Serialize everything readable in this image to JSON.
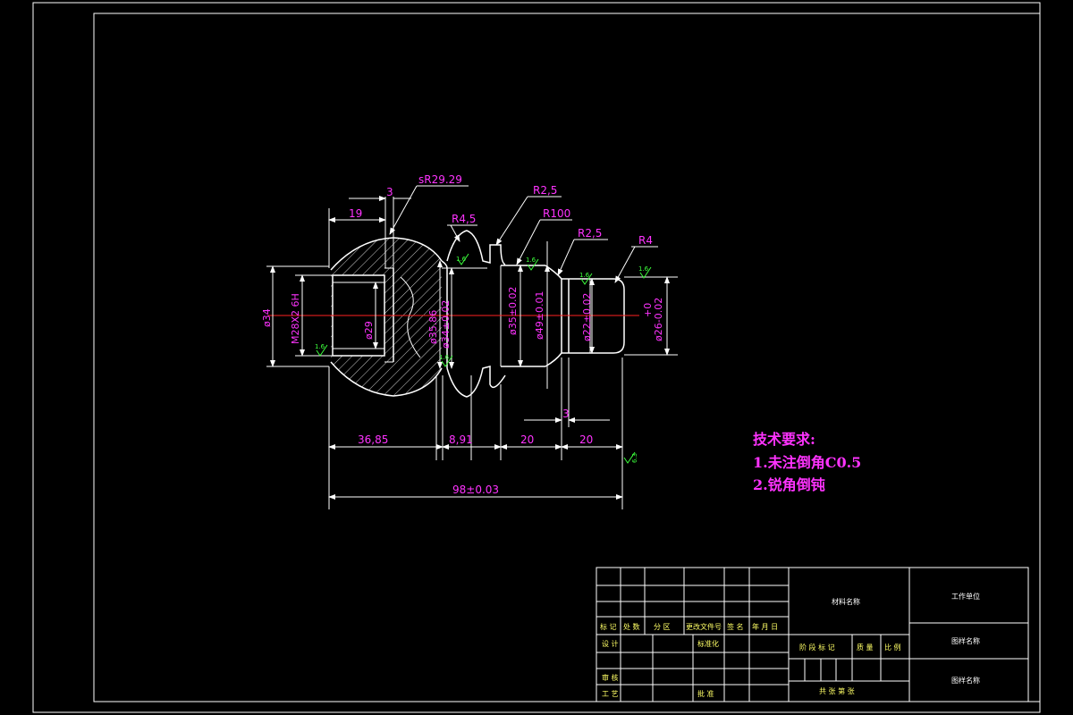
{
  "dimensions": {
    "sr": "sR29.29",
    "d3_top": "3",
    "d19": "19",
    "r45": "R4,5",
    "r25a": "R2,5",
    "r100": "R100",
    "r25b": "R2,5",
    "r4": "R4",
    "phi34": "ø34",
    "m28": "M28X2 6H",
    "phi29": "ø29",
    "phi3586": "ø35.86",
    "phi34tol": "ø34±0.02",
    "phi35tol": "ø35±0.02",
    "phi49": "ø49±0.01",
    "phi22": "ø22±0.02",
    "phi26": "ø26-0.02",
    "phi26_upper": "+0",
    "d3_bottom": "3",
    "d3685": "36,85",
    "d891": "8,91",
    "d20a": "20",
    "d20b": "20",
    "d98": "98±0.03"
  },
  "roughness": {
    "r1": "1.6",
    "r2": "1.6",
    "r3": "1.6",
    "r4": "1.6",
    "r5": "1.6",
    "r6": "1.6",
    "r7": "6.3"
  },
  "notes": {
    "title": "技术要求:",
    "line1": "1.未注倒角C0.5",
    "line2": "2.锐角倒钝"
  },
  "title_block": {
    "h_mark": "标 记",
    "h_count": "处 数",
    "h_zone": "分  区",
    "h_docno": "更改文件号",
    "h_sign": "签  名",
    "h_date": "年 月 日",
    "design": "设 计",
    "standard": "标准化",
    "review": "审 核",
    "process": "工 艺",
    "approve": "批 准",
    "material": "材料名称",
    "stage": "阶 段 标 记",
    "weight": "质 量",
    "scale": "比 例",
    "sheets": "共   张   第   张",
    "company": "工作单位",
    "drawing_name": "图样名称",
    "drawing_no": "图样名称"
  }
}
